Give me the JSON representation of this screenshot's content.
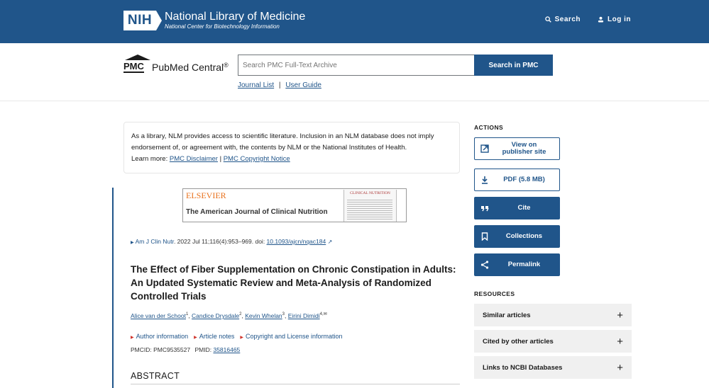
{
  "colors": {
    "brand": "#20558a",
    "accent_red": "#d0342c",
    "elsevier_orange": "#e9711c"
  },
  "header": {
    "logo_badge": "NIH",
    "title": "National Library of Medicine",
    "subtitle": "National Center for Biotechnology Information",
    "search_label": "Search",
    "login_label": "Log in"
  },
  "pmc": {
    "abbr": "PMC",
    "name": "PubMed Central",
    "registered": "®",
    "search_placeholder": "Search PMC Full-Text Archive",
    "search_button": "Search in PMC",
    "journal_list": "Journal List",
    "separator": "|",
    "user_guide": "User Guide"
  },
  "disclaimer": {
    "text": "As a library, NLM provides access to scientific literature. Inclusion in an NLM database does not imply endorsement of, or agreement with, the contents by NLM or the National Institutes of Health.",
    "learn_more": "Learn more:",
    "link1": "PMC Disclaimer",
    "sep": "|",
    "link2": "PMC Copyright Notice"
  },
  "banner": {
    "publisher": "ELSEVIER",
    "journal": "The American Journal of Clinical Nutrition",
    "cover_title": "CLINICAL NUTRITION"
  },
  "citation": {
    "journal_abbr": "Am J Clin Nutr",
    "details": ". 2022 Jul 11;116(4):953–969. doi: ",
    "doi": "10.1093/ajcn/nqac184"
  },
  "article": {
    "title": "The Effect of Fiber Supplementation on Chronic Constipation in Adults: An Updated Systematic Review and Meta-Analysis of Randomized Controlled Trials",
    "authors": [
      {
        "name": "Alice van der Schoot",
        "sup": "1"
      },
      {
        "name": "Candice Drysdale",
        "sup": "2"
      },
      {
        "name": "Kevin Whelan",
        "sup": "3"
      },
      {
        "name": "Eirini Dimidi",
        "sup": "4,✉"
      }
    ],
    "info_links": [
      "Author information",
      "Article notes",
      "Copyright and License information"
    ],
    "pmcid_label": "PMCID: PMC9535527",
    "pmid_label": "PMID:",
    "pmid": "35816465",
    "abstract_heading": "ABSTRACT"
  },
  "sidebar": {
    "actions_heading": "ACTIONS",
    "actions": [
      {
        "label": "View on publisher site",
        "icon": "external-link-icon"
      },
      {
        "label": "PDF (5.8 MB)",
        "icon": "download-icon"
      },
      {
        "label": "Cite",
        "icon": "quote-icon"
      },
      {
        "label": "Collections",
        "icon": "bookmark-icon"
      },
      {
        "label": "Permalink",
        "icon": "share-icon"
      }
    ],
    "resources_heading": "RESOURCES",
    "resources": [
      "Similar articles",
      "Cited by other articles",
      "Links to NCBI Databases"
    ],
    "expand_symbol": "+"
  }
}
